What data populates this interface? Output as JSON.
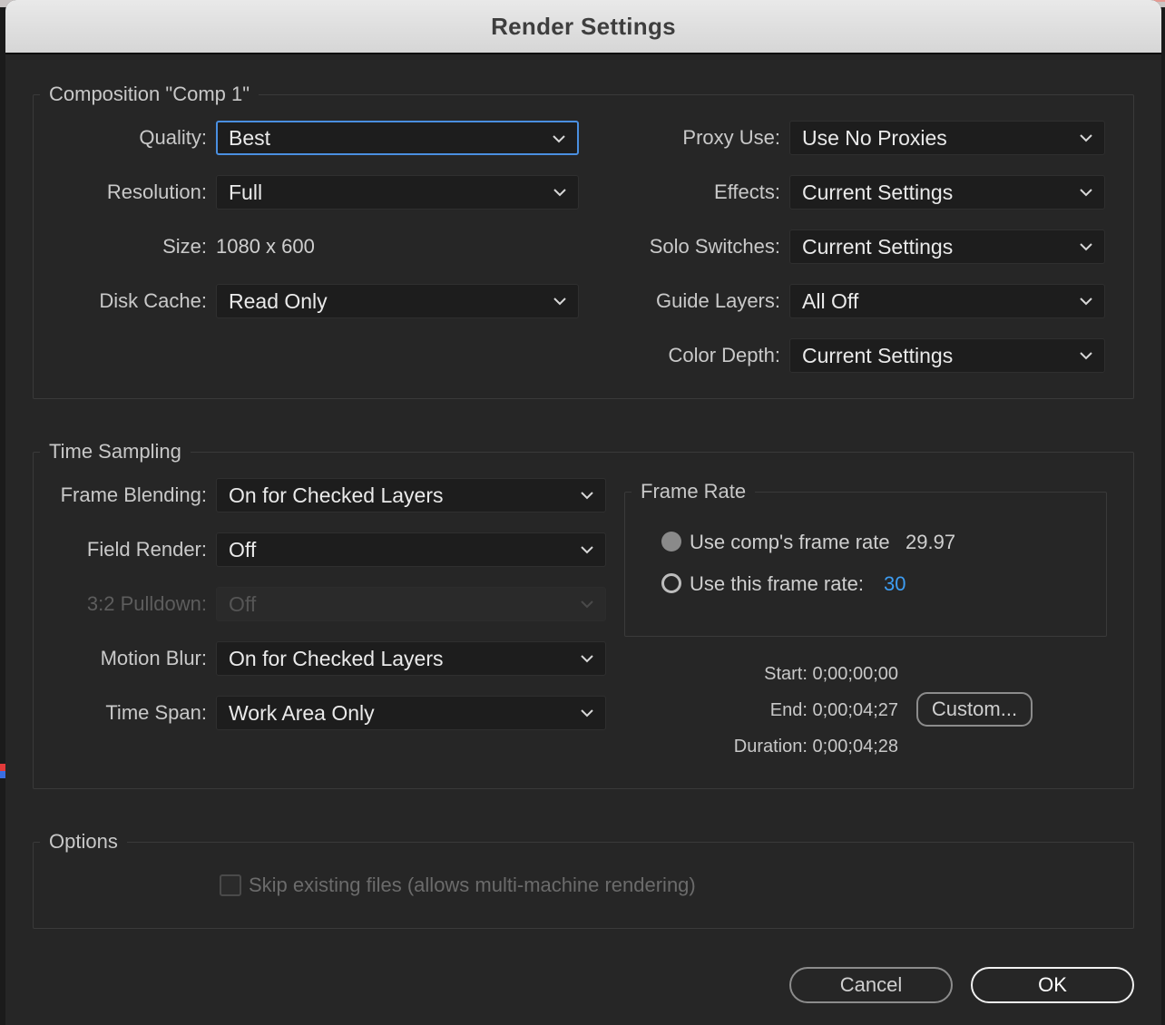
{
  "dialog": {
    "title": "Render Settings"
  },
  "composition": {
    "legend": "Composition \"Comp 1\"",
    "quality": {
      "label": "Quality:",
      "value": "Best"
    },
    "resolution": {
      "label": "Resolution:",
      "value": "Full"
    },
    "size": {
      "label": "Size:",
      "value": "1080 x 600"
    },
    "disk_cache": {
      "label": "Disk Cache:",
      "value": "Read Only"
    },
    "proxy_use": {
      "label": "Proxy Use:",
      "value": "Use No Proxies"
    },
    "effects": {
      "label": "Effects:",
      "value": "Current Settings"
    },
    "solo_switches": {
      "label": "Solo Switches:",
      "value": "Current Settings"
    },
    "guide_layers": {
      "label": "Guide Layers:",
      "value": "All Off"
    },
    "color_depth": {
      "label": "Color Depth:",
      "value": "Current Settings"
    }
  },
  "time_sampling": {
    "legend": "Time Sampling",
    "frame_blending": {
      "label": "Frame Blending:",
      "value": "On for Checked Layers"
    },
    "field_render": {
      "label": "Field Render:",
      "value": "Off"
    },
    "pulldown": {
      "label": "3:2 Pulldown:",
      "value": "Off",
      "disabled": true
    },
    "motion_blur": {
      "label": "Motion Blur:",
      "value": "On for Checked Layers"
    },
    "time_span": {
      "label": "Time Span:",
      "value": "Work Area Only"
    },
    "frame_rate": {
      "legend": "Frame Rate",
      "use_comp": {
        "label": "Use comp's frame rate",
        "value": "29.97",
        "selected": true
      },
      "use_this": {
        "label": "Use this frame rate:",
        "value": "30",
        "selected": false
      }
    },
    "start": "Start: 0;00;00;00",
    "end": "End: 0;00;04;27",
    "duration": "Duration: 0;00;04;28",
    "custom_button": "Custom..."
  },
  "options": {
    "legend": "Options",
    "skip_existing": {
      "label": "Skip existing files (allows multi-machine rendering)",
      "checked": false,
      "disabled": true
    }
  },
  "buttons": {
    "cancel": "Cancel",
    "ok": "OK"
  },
  "colors": {
    "accent": "#4a8fe0",
    "link": "#3d9df3",
    "background": "#262626"
  }
}
